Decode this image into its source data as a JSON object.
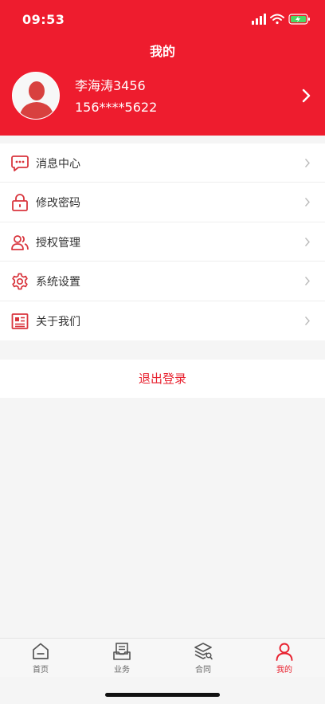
{
  "status_bar": {
    "time": "09:53"
  },
  "header": {
    "title": "我的"
  },
  "profile": {
    "name": "李海涛3456",
    "phone": "156****5622"
  },
  "menu": {
    "items": [
      {
        "label": "消息中心",
        "icon": "message-icon"
      },
      {
        "label": "修改密码",
        "icon": "lock-icon"
      },
      {
        "label": "授权管理",
        "icon": "users-icon"
      },
      {
        "label": "系统设置",
        "icon": "gear-icon"
      },
      {
        "label": "关于我们",
        "icon": "newspaper-icon"
      }
    ]
  },
  "logout": {
    "label": "退出登录"
  },
  "tabbar": {
    "tabs": [
      {
        "label": "首页",
        "icon": "home-icon",
        "active": false
      },
      {
        "label": "业务",
        "icon": "business-icon",
        "active": false
      },
      {
        "label": "合同",
        "icon": "contract-icon",
        "active": false
      },
      {
        "label": "我的",
        "icon": "person-icon",
        "active": true
      }
    ]
  },
  "colors": {
    "brand": "#ee1c2e",
    "accent": "#e8202e",
    "background": "#f5f5f5",
    "inactive": "#666666"
  }
}
